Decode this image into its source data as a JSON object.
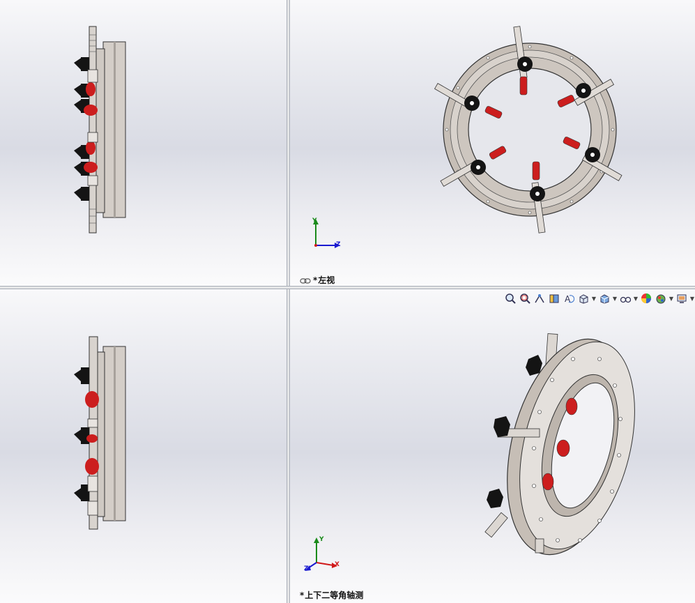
{
  "viewports": {
    "top_right": {
      "label": "左视",
      "modified_marker": "*"
    },
    "bottom_right": {
      "label": "上下二等角轴测",
      "modified_marker": "*"
    }
  },
  "triad": {
    "axis_y": "Y",
    "axis_z": "Z",
    "axis_x": "X"
  },
  "view_toolbar": {
    "buttons": [
      {
        "icon": "zoom-to-fit-icon"
      },
      {
        "icon": "zoom-to-area-icon"
      },
      {
        "icon": "previous-view-icon"
      },
      {
        "icon": "section-view-icon"
      },
      {
        "icon": "dynamic-annotation-icon"
      },
      {
        "icon": "view-orientation-icon"
      },
      {
        "icon": "display-style-icon"
      },
      {
        "icon": "hide-show-items-icon"
      },
      {
        "icon": "edit-appearance-icon"
      },
      {
        "icon": "apply-scene-icon"
      },
      {
        "icon": "view-settings-icon"
      }
    ]
  },
  "colors": {
    "clamp_red": "#cc1e1e",
    "knob_black": "#141414",
    "ring_metal": "#c9c2bb",
    "axis_y": "#1a8a1a",
    "axis_z": "#1a1ad0",
    "axis_x": "#d01a1a"
  }
}
